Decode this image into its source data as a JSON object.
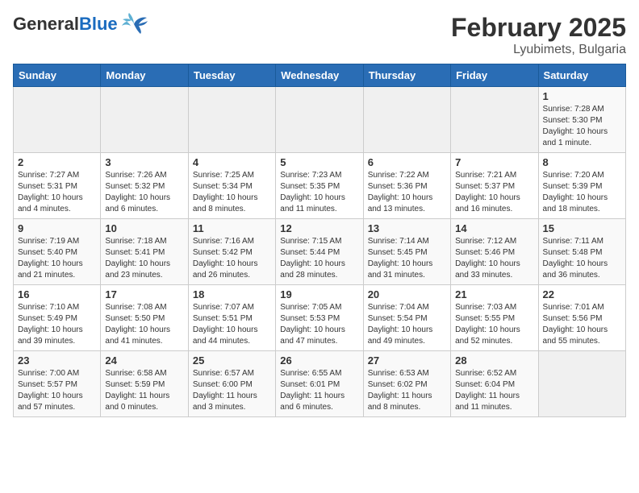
{
  "header": {
    "logo_general": "General",
    "logo_blue": "Blue",
    "month_year": "February 2025",
    "location": "Lyubimets, Bulgaria"
  },
  "days_of_week": [
    "Sunday",
    "Monday",
    "Tuesday",
    "Wednesday",
    "Thursday",
    "Friday",
    "Saturday"
  ],
  "weeks": [
    [
      {
        "day": "",
        "info": ""
      },
      {
        "day": "",
        "info": ""
      },
      {
        "day": "",
        "info": ""
      },
      {
        "day": "",
        "info": ""
      },
      {
        "day": "",
        "info": ""
      },
      {
        "day": "",
        "info": ""
      },
      {
        "day": "1",
        "info": "Sunrise: 7:28 AM\nSunset: 5:30 PM\nDaylight: 10 hours\nand 1 minute."
      }
    ],
    [
      {
        "day": "2",
        "info": "Sunrise: 7:27 AM\nSunset: 5:31 PM\nDaylight: 10 hours\nand 4 minutes."
      },
      {
        "day": "3",
        "info": "Sunrise: 7:26 AM\nSunset: 5:32 PM\nDaylight: 10 hours\nand 6 minutes."
      },
      {
        "day": "4",
        "info": "Sunrise: 7:25 AM\nSunset: 5:34 PM\nDaylight: 10 hours\nand 8 minutes."
      },
      {
        "day": "5",
        "info": "Sunrise: 7:23 AM\nSunset: 5:35 PM\nDaylight: 10 hours\nand 11 minutes."
      },
      {
        "day": "6",
        "info": "Sunrise: 7:22 AM\nSunset: 5:36 PM\nDaylight: 10 hours\nand 13 minutes."
      },
      {
        "day": "7",
        "info": "Sunrise: 7:21 AM\nSunset: 5:37 PM\nDaylight: 10 hours\nand 16 minutes."
      },
      {
        "day": "8",
        "info": "Sunrise: 7:20 AM\nSunset: 5:39 PM\nDaylight: 10 hours\nand 18 minutes."
      }
    ],
    [
      {
        "day": "9",
        "info": "Sunrise: 7:19 AM\nSunset: 5:40 PM\nDaylight: 10 hours\nand 21 minutes."
      },
      {
        "day": "10",
        "info": "Sunrise: 7:18 AM\nSunset: 5:41 PM\nDaylight: 10 hours\nand 23 minutes."
      },
      {
        "day": "11",
        "info": "Sunrise: 7:16 AM\nSunset: 5:42 PM\nDaylight: 10 hours\nand 26 minutes."
      },
      {
        "day": "12",
        "info": "Sunrise: 7:15 AM\nSunset: 5:44 PM\nDaylight: 10 hours\nand 28 minutes."
      },
      {
        "day": "13",
        "info": "Sunrise: 7:14 AM\nSunset: 5:45 PM\nDaylight: 10 hours\nand 31 minutes."
      },
      {
        "day": "14",
        "info": "Sunrise: 7:12 AM\nSunset: 5:46 PM\nDaylight: 10 hours\nand 33 minutes."
      },
      {
        "day": "15",
        "info": "Sunrise: 7:11 AM\nSunset: 5:48 PM\nDaylight: 10 hours\nand 36 minutes."
      }
    ],
    [
      {
        "day": "16",
        "info": "Sunrise: 7:10 AM\nSunset: 5:49 PM\nDaylight: 10 hours\nand 39 minutes."
      },
      {
        "day": "17",
        "info": "Sunrise: 7:08 AM\nSunset: 5:50 PM\nDaylight: 10 hours\nand 41 minutes."
      },
      {
        "day": "18",
        "info": "Sunrise: 7:07 AM\nSunset: 5:51 PM\nDaylight: 10 hours\nand 44 minutes."
      },
      {
        "day": "19",
        "info": "Sunrise: 7:05 AM\nSunset: 5:53 PM\nDaylight: 10 hours\nand 47 minutes."
      },
      {
        "day": "20",
        "info": "Sunrise: 7:04 AM\nSunset: 5:54 PM\nDaylight: 10 hours\nand 49 minutes."
      },
      {
        "day": "21",
        "info": "Sunrise: 7:03 AM\nSunset: 5:55 PM\nDaylight: 10 hours\nand 52 minutes."
      },
      {
        "day": "22",
        "info": "Sunrise: 7:01 AM\nSunset: 5:56 PM\nDaylight: 10 hours\nand 55 minutes."
      }
    ],
    [
      {
        "day": "23",
        "info": "Sunrise: 7:00 AM\nSunset: 5:57 PM\nDaylight: 10 hours\nand 57 minutes."
      },
      {
        "day": "24",
        "info": "Sunrise: 6:58 AM\nSunset: 5:59 PM\nDaylight: 11 hours\nand 0 minutes."
      },
      {
        "day": "25",
        "info": "Sunrise: 6:57 AM\nSunset: 6:00 PM\nDaylight: 11 hours\nand 3 minutes."
      },
      {
        "day": "26",
        "info": "Sunrise: 6:55 AM\nSunset: 6:01 PM\nDaylight: 11 hours\nand 6 minutes."
      },
      {
        "day": "27",
        "info": "Sunrise: 6:53 AM\nSunset: 6:02 PM\nDaylight: 11 hours\nand 8 minutes."
      },
      {
        "day": "28",
        "info": "Sunrise: 6:52 AM\nSunset: 6:04 PM\nDaylight: 11 hours\nand 11 minutes."
      },
      {
        "day": "",
        "info": ""
      }
    ]
  ]
}
